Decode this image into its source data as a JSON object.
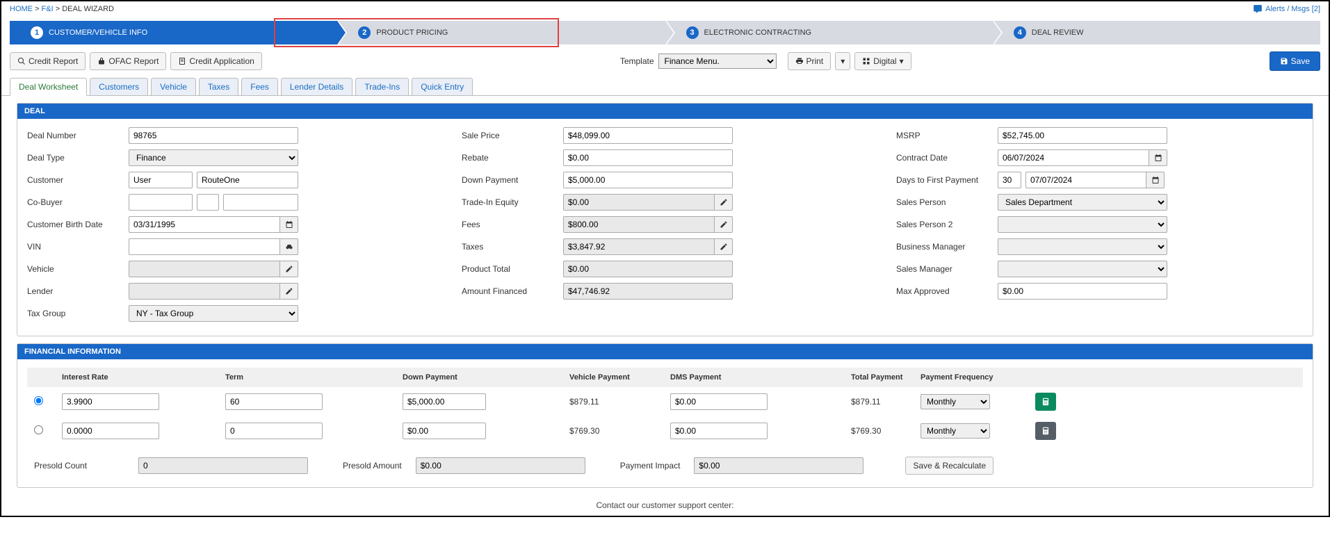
{
  "breadcrumb": {
    "home": "HOME",
    "fi": "F&I",
    "current": "DEAL WIZARD"
  },
  "alerts_label": "Alerts / Msgs [2]",
  "steps": {
    "s1": "CUSTOMER/VEHICLE INFO",
    "s2": "PRODUCT PRICING",
    "s3": "ELECTRONIC CONTRACTING",
    "s4": "DEAL REVIEW"
  },
  "actions": {
    "credit_report": "Credit Report",
    "ofac_report": "OFAC Report",
    "credit_application": "Credit Application",
    "template_label": "Template",
    "template_value": "Finance Menu.",
    "print": "Print",
    "digital": "Digital",
    "save": "Save"
  },
  "tabs": {
    "deal_worksheet": "Deal Worksheet",
    "customers": "Customers",
    "vehicle": "Vehicle",
    "taxes": "Taxes",
    "fees": "Fees",
    "lender_details": "Lender Details",
    "trade_ins": "Trade-Ins",
    "quick_entry": "Quick Entry"
  },
  "deal_header": "DEAL",
  "financial_header": "FINANCIAL INFORMATION",
  "labels": {
    "deal_number": "Deal Number",
    "deal_type": "Deal Type",
    "customer": "Customer",
    "co_buyer": "Co-Buyer",
    "dob": "Customer Birth Date",
    "vin": "VIN",
    "vehicle": "Vehicle",
    "lender": "Lender",
    "tax_group": "Tax Group",
    "sale_price": "Sale Price",
    "rebate": "Rebate",
    "down_payment": "Down Payment",
    "trade_in": "Trade-In Equity",
    "fees": "Fees",
    "taxes": "Taxes",
    "product_total": "Product Total",
    "amount_financed": "Amount Financed",
    "msrp": "MSRP",
    "contract_date": "Contract Date",
    "days_first": "Days to First Payment",
    "sales_person": "Sales Person",
    "sales_person2": "Sales Person 2",
    "business_manager": "Business Manager",
    "sales_manager": "Sales Manager",
    "max_approved": "Max Approved"
  },
  "values": {
    "deal_number": "98765",
    "deal_type": "Finance",
    "customer_first": "User",
    "customer_last": "RouteOne",
    "cobuyer_first": "",
    "cobuyer_mid": "",
    "cobuyer_last": "",
    "dob": "03/31/1995",
    "vin": "",
    "vehicle": "",
    "lender": "",
    "tax_group": "NY - Tax Group",
    "sale_price": "$48,099.00",
    "rebate": "$0.00",
    "down_payment": "$5,000.00",
    "trade_in": "$0.00",
    "fees": "$800.00",
    "taxes": "$3,847.92",
    "product_total": "$0.00",
    "amount_financed": "$47,746.92",
    "msrp": "$52,745.00",
    "contract_date": "06/07/2024",
    "days_first": "30",
    "first_payment_date": "07/07/2024",
    "sales_person": "Sales Department",
    "sales_person2": "",
    "business_manager": "",
    "sales_manager": "",
    "max_approved": "$0.00"
  },
  "fin_cols": {
    "rate": "Interest Rate",
    "term": "Term",
    "down": "Down Payment",
    "vehicle_pay": "Vehicle Payment",
    "dms_pay": "DMS Payment",
    "total_pay": "Total Payment",
    "freq": "Payment Frequency"
  },
  "fin_rows": [
    {
      "rate": "3.9900",
      "term": "60",
      "down": "$5,000.00",
      "veh": "$879.11",
      "dms": "$0.00",
      "total": "$879.11",
      "freq": "Monthly"
    },
    {
      "rate": "0.0000",
      "term": "0",
      "down": "$0.00",
      "veh": "$769.30",
      "dms": "$0.00",
      "total": "$769.30",
      "freq": "Monthly"
    }
  ],
  "presold": {
    "count_label": "Presold Count",
    "count": "0",
    "amount_label": "Presold Amount",
    "amount": "$0.00",
    "impact_label": "Payment Impact",
    "impact": "$0.00",
    "save_recalc": "Save & Recalculate"
  },
  "footer": "Contact our customer support center:"
}
